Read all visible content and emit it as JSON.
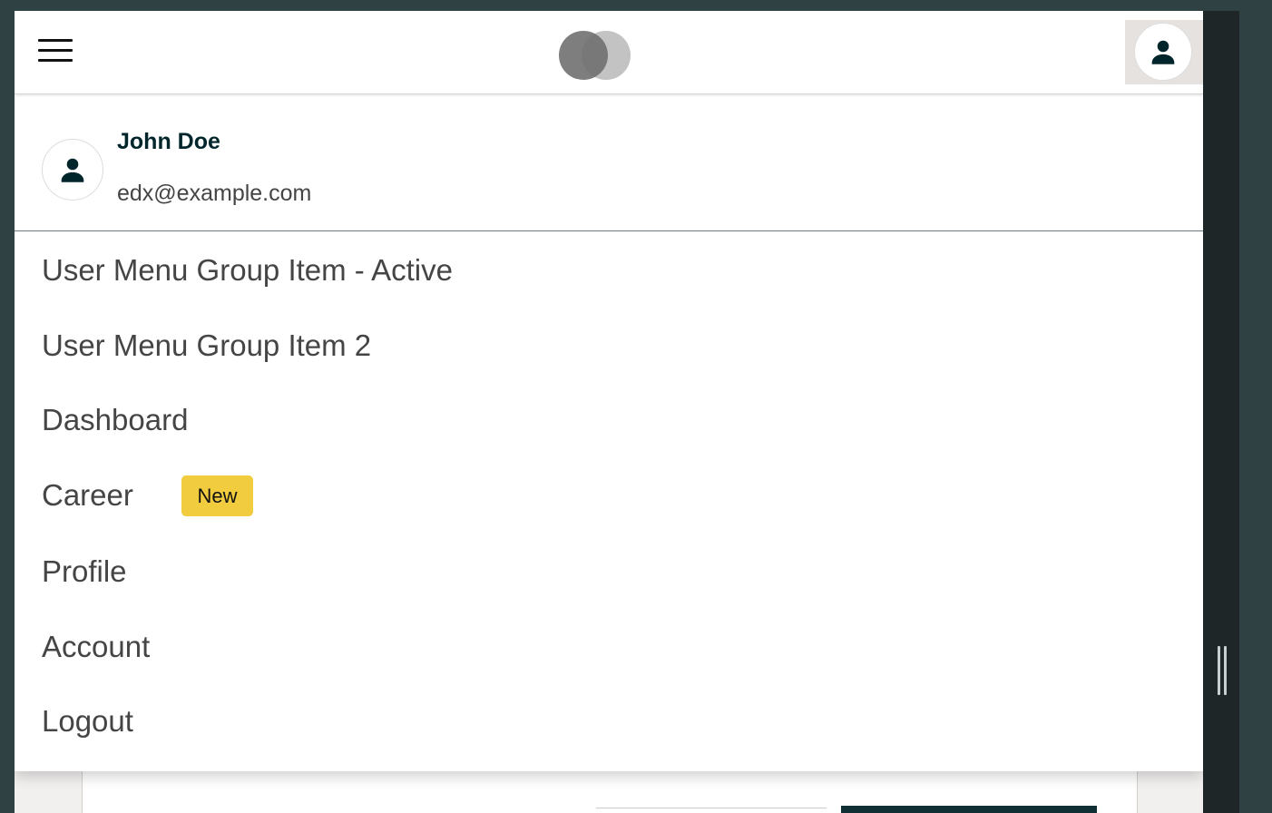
{
  "app": {
    "colors": {
      "background": "#2f4143",
      "side_panel": "#1f2627",
      "header_bg": "#ffffff",
      "avatar_button_bg": "#e5e2df",
      "text_dark": "#00262b",
      "text_muted": "#454545",
      "badge_bg": "#f0cc3e",
      "divider": "#6a7b86"
    }
  },
  "header": {
    "menu_icon": "hamburger-icon",
    "logo_icon": "overlapping-circles-logo",
    "avatar_icon": "user-icon"
  },
  "user_menu": {
    "profile": {
      "name": "John Doe",
      "email": "edx@example.com",
      "avatar_icon": "user-icon"
    },
    "items": [
      {
        "label": "User Menu Group Item - Active"
      },
      {
        "label": "User Menu Group Item 2"
      },
      {
        "label": "Dashboard"
      },
      {
        "label": "Career",
        "badge": "New"
      },
      {
        "label": "Profile"
      },
      {
        "label": "Account"
      },
      {
        "label": "Logout"
      }
    ]
  }
}
